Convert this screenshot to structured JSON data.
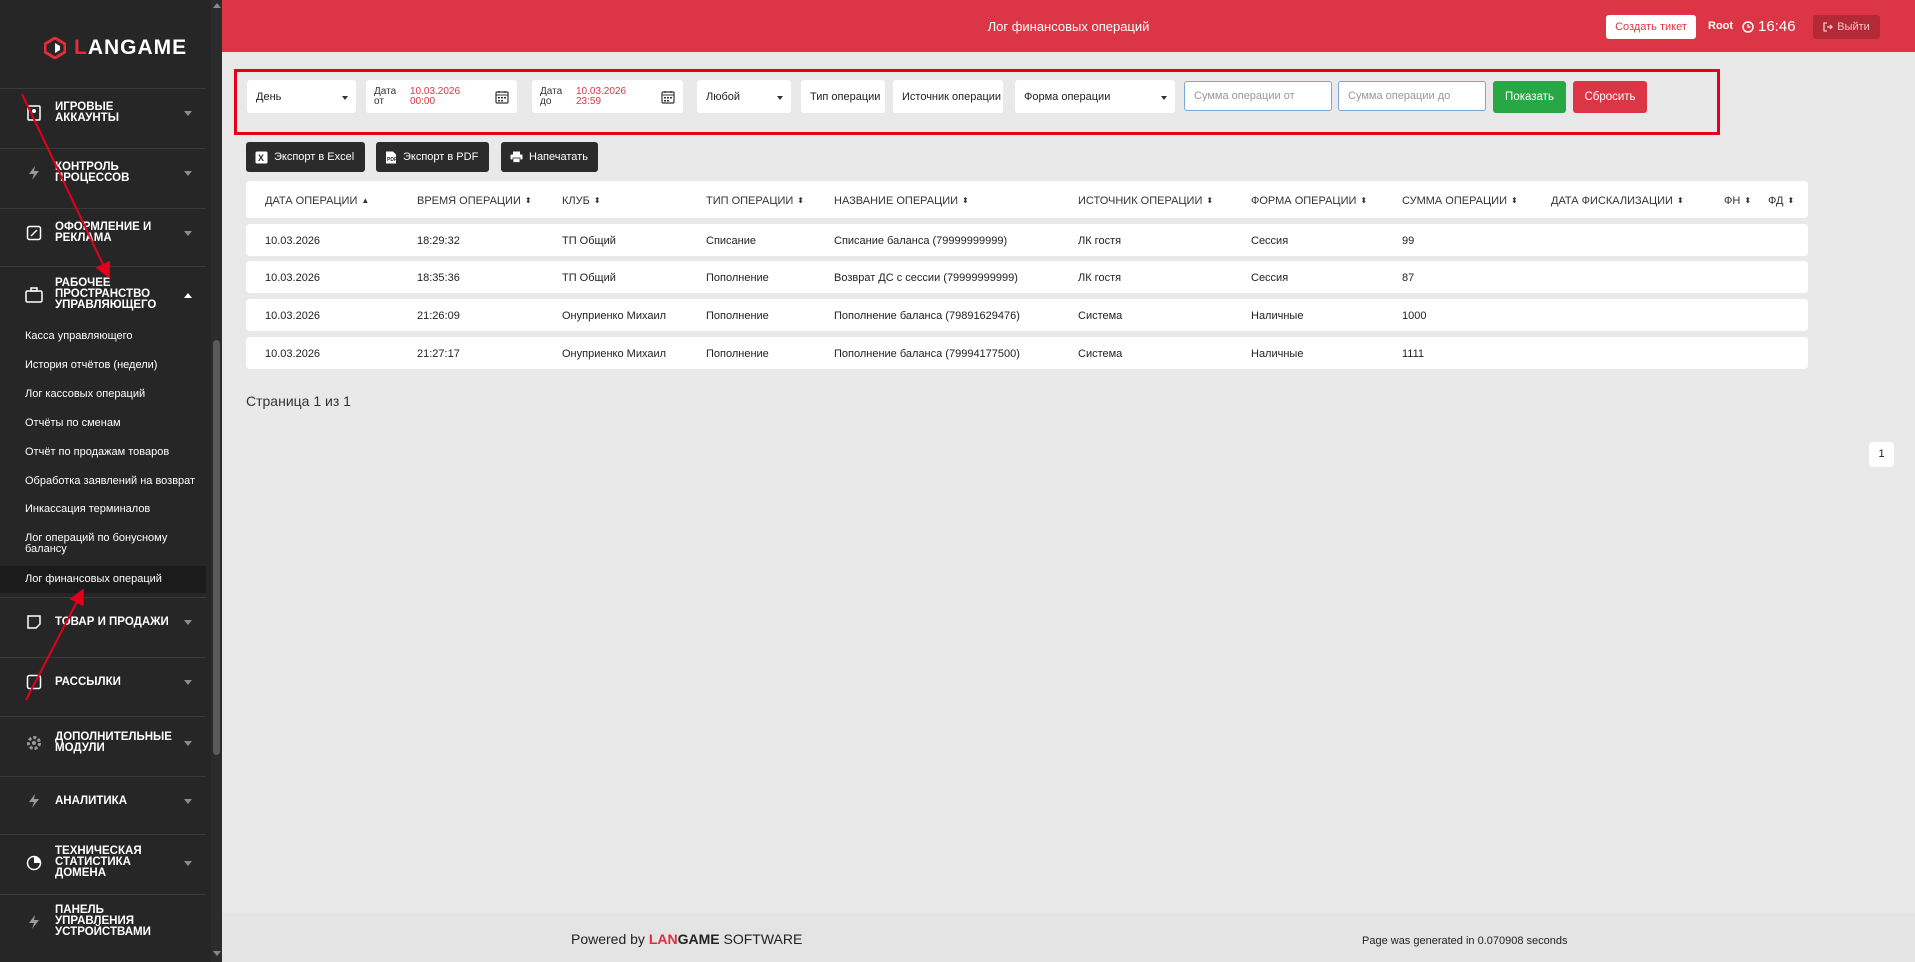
{
  "brand": {
    "logo_text_red": "L",
    "logo_text_white": "ANGAME"
  },
  "header": {
    "title": "Лог финансовых операций",
    "ticket_button": "Создать тикет",
    "user": "Root",
    "time": "16:46",
    "logout": "Выйти"
  },
  "sidebar": {
    "sections_top": [
      {
        "label": "ИГРОВЫЕ АККАУНТЫ",
        "icon": "account-icon"
      },
      {
        "label": "КОНТРОЛЬ ПРОЦЕССОВ",
        "icon": "bolt-icon"
      },
      {
        "label": "ОФОРМЛЕНИЕ И РЕКЛАМА",
        "icon": "edit-icon"
      },
      {
        "label": "РАБОЧЕЕ ПРОСТРАНСТВО УПРАВЛЯЮЩЕГО",
        "icon": "briefcase-icon"
      }
    ],
    "sub_items": [
      "Касса управляющего",
      "История отчётов (недели)",
      "Лог кассовых операций",
      "Отчёты по сменам",
      "Отчёт по продажам товаров",
      "Обработка заявлений на возврат",
      "Инкассация терминалов",
      "Лог операций по бонусному балансу",
      "Лог финансовых операций"
    ],
    "sections_bottom": [
      {
        "label": "ТОВАР И ПРОДАЖИ",
        "icon": "note-icon"
      },
      {
        "label": "РАССЫЛКИ",
        "icon": "mail-icon"
      },
      {
        "label": "ДОПОЛНИТЕЛЬНЫЕ МОДУЛИ",
        "icon": "gear-icon"
      },
      {
        "label": "АНАЛИТИКА",
        "icon": "bolt-icon"
      },
      {
        "label": "ТЕХНИЧЕСКАЯ СТАТИСТИКА ДОМЕНА",
        "icon": "pie-icon"
      },
      {
        "label": "ПАНЕЛЬ УПРАВЛЕНИЯ УСТРОЙСТВАМИ",
        "icon": "bolt-icon"
      }
    ]
  },
  "filters": {
    "period": "День",
    "date_from_label_1": "Дата",
    "date_from_label_2": "от",
    "date_from_value_1": "10.03.2026",
    "date_from_value_2": "00:00",
    "date_to_label_1": "Дата",
    "date_to_label_2": "до",
    "date_to_value_1": "10.03.2026",
    "date_to_value_2": "23:59",
    "club": "Любой",
    "op_type": "Тип операции",
    "op_source": "Источник операции",
    "op_form": "Форма операции",
    "sum_from_placeholder": "Сумма операции от",
    "sum_to_placeholder": "Сумма операции до",
    "show": "Показать",
    "reset": "Сбросить"
  },
  "exports": {
    "excel": "Экспорт в Excel",
    "pdf": "Экспорт в PDF",
    "print": "Напечатать"
  },
  "table": {
    "columns": [
      "ДАТА ОПЕРАЦИИ",
      "ВРЕМЯ ОПЕРАЦИИ",
      "КЛУБ",
      "ТИП ОПЕРАЦИИ",
      "НАЗВАНИЕ ОПЕРАЦИИ",
      "ИСТОЧНИК ОПЕРАЦИИ",
      "ФОРМА ОПЕРАЦИИ",
      "СУММА ОПЕРАЦИИ",
      "ДАТА ФИСКАЛИЗАЦИИ",
      "ФН",
      "ФД"
    ],
    "rows": [
      [
        "10.03.2026",
        "18:29:32",
        "ТП Общий",
        "Списание",
        "Списание баланса (79999999999)",
        "ЛК гостя",
        "Сессия",
        "99",
        "",
        "",
        ""
      ],
      [
        "10.03.2026",
        "18:35:36",
        "ТП Общий",
        "Пополнение",
        "Возврат ДС с сессии (79999999999)",
        "ЛК гостя",
        "Сессия",
        "87",
        "",
        "",
        ""
      ],
      [
        "10.03.2026",
        "21:26:09",
        "Онуприенко Михаил",
        "Пополнение",
        "Пополнение баланса (79891629476)",
        "Система",
        "Наличные",
        "1000",
        "",
        "",
        ""
      ],
      [
        "10.03.2026",
        "21:27:17",
        "Онуприенко Михаил",
        "Пополнение",
        "Пополнение баланса (79994177500)",
        "Система",
        "Наличные",
        "1111",
        "",
        "",
        ""
      ]
    ]
  },
  "pagination": {
    "text": "Страница 1 из 1",
    "current": "1"
  },
  "footer": {
    "powered_prefix": "Powered by ",
    "brand_red": "LAN",
    "brand_dark": "GAME",
    "powered_suffix": " SOFTWARE",
    "generated": "Page was generated in 0.070908 seconds"
  },
  "colors": {
    "accent": "#dc3545",
    "success": "#28a745",
    "sidebar": "#262626"
  }
}
